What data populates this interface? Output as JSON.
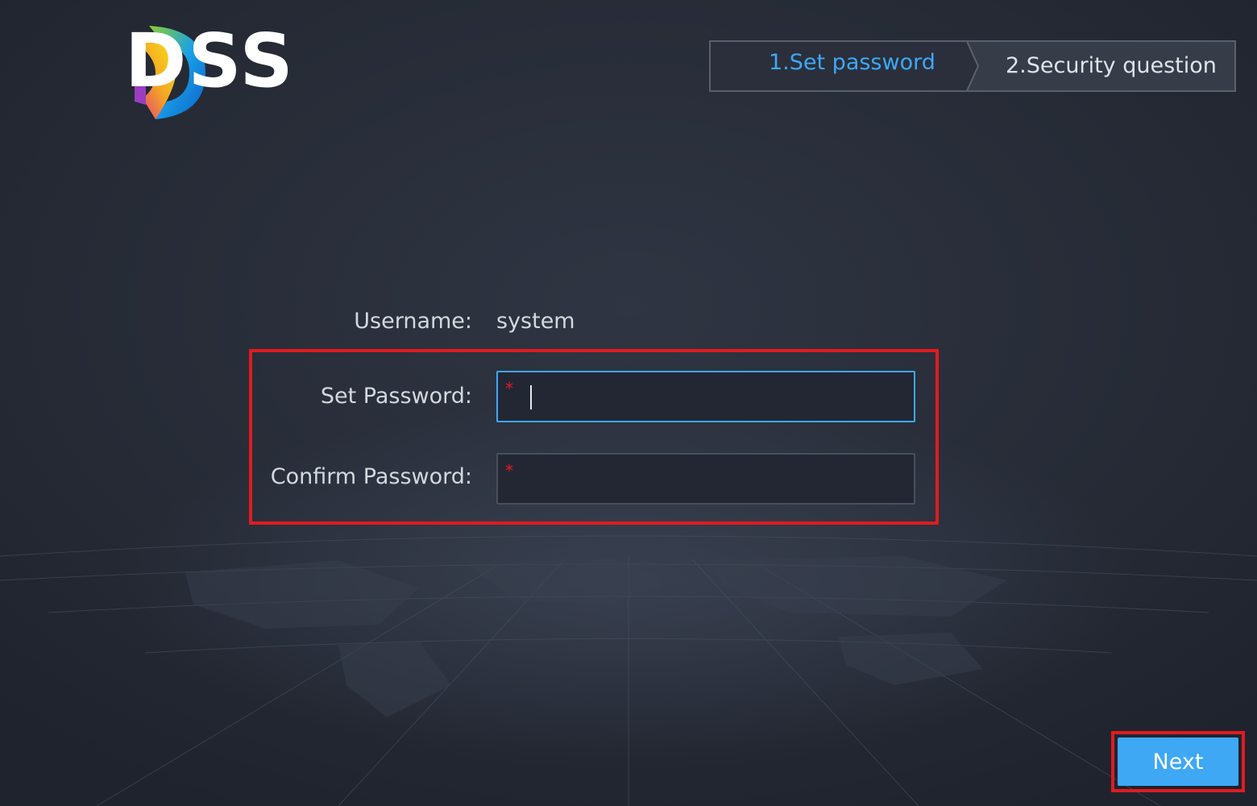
{
  "brand": {
    "logo_text": "DSS"
  },
  "steps": [
    {
      "label": "1.Set password",
      "active": true
    },
    {
      "label": "2.Security question",
      "active": false
    }
  ],
  "form": {
    "username_label": "Username:",
    "username_value": "system",
    "set_password_label": "Set Password:",
    "confirm_password_label": "Confirm Password:",
    "required_mark": "*",
    "set_password_value": "",
    "confirm_password_value": ""
  },
  "actions": {
    "next_label": "Next"
  },
  "colors": {
    "accent": "#3ea8f5",
    "background": "#252a35",
    "highlight": "#e01b20",
    "required": "#e01b20"
  }
}
